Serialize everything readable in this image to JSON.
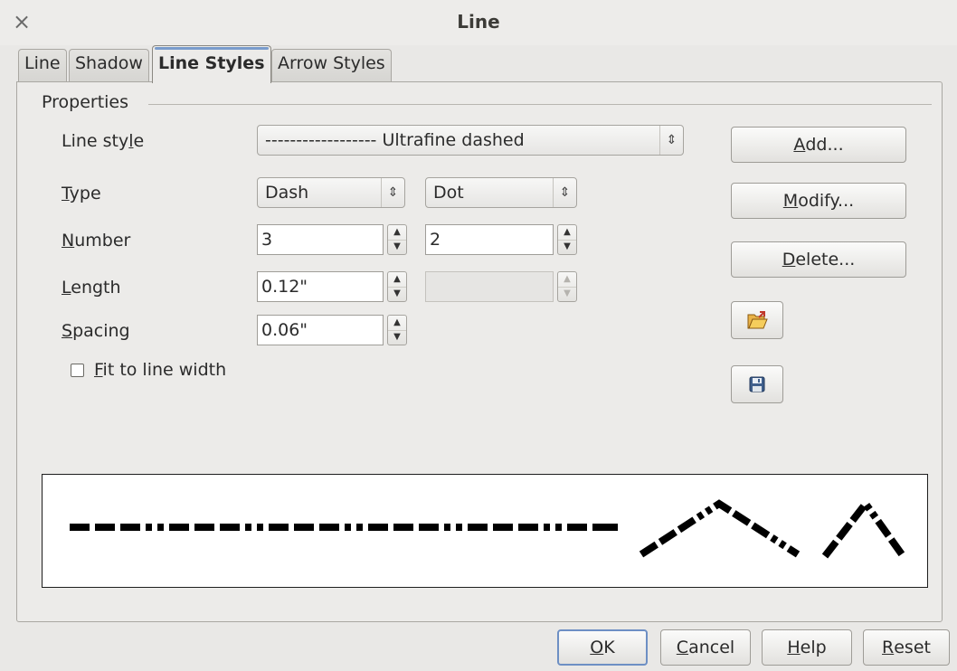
{
  "window": {
    "title": "Line",
    "close_glyph": "×"
  },
  "tabs": [
    {
      "label": "Line",
      "active": false
    },
    {
      "label": "Shadow",
      "active": false
    },
    {
      "label": "Line Styles",
      "active": true
    },
    {
      "label": "Arrow Styles",
      "active": false
    }
  ],
  "properties": {
    "section_label": "Properties",
    "line_style": {
      "label_pre": "Line sty",
      "label_mn": "l",
      "label_post": "e",
      "value": "------------------ Ultrafine dashed"
    },
    "type": {
      "label_mn": "T",
      "label_post": "ype",
      "first": "Dash",
      "second": "Dot"
    },
    "number": {
      "label_mn": "N",
      "label_post": "umber",
      "first": "3",
      "second": "2"
    },
    "length": {
      "label_mn": "L",
      "label_post": "ength",
      "first": "0.12\"",
      "second": ""
    },
    "spacing": {
      "label_mn": "S",
      "label_post": "pacing",
      "value": "0.06\""
    },
    "fit_to_line_width": {
      "label_mn": "F",
      "label_post": "it to line width",
      "checked": false
    }
  },
  "side_buttons": {
    "add": {
      "mn": "A",
      "rest": "dd..."
    },
    "modify": {
      "mn": "M",
      "rest": "odify..."
    },
    "delete": {
      "mn": "D",
      "rest": "elete..."
    },
    "load_icon": "folder-open-icon",
    "save_icon": "save-disk-icon"
  },
  "footer": {
    "ok": {
      "mn": "O",
      "rest": "K"
    },
    "cancel": {
      "mn": "C",
      "rest": "ancel"
    },
    "help": {
      "mn": "H",
      "rest": "elp"
    },
    "reset": {
      "mn": "R",
      "rest": "eset"
    }
  },
  "colors": {
    "accent": "#6d8fc4",
    "dialog_bg": "#ecebe9",
    "preview_stroke": "#000000"
  }
}
